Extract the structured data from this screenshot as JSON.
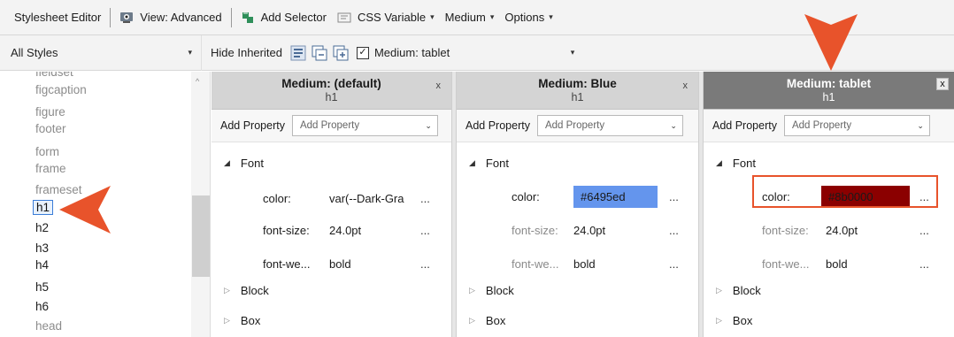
{
  "toolbar": {
    "title": "Stylesheet Editor",
    "view": "View: Advanced",
    "add_selector": "Add Selector",
    "css_variable": "CSS Variable",
    "medium": "Medium",
    "options": "Options"
  },
  "toolbar2": {
    "styles_filter": "All Styles",
    "hide_inherited": "Hide Inherited",
    "medium_check": "Medium: tablet"
  },
  "selector_list": {
    "items": [
      "fieldset",
      "figcaption",
      "figure",
      "footer",
      "form",
      "frame",
      "frameset",
      "h1",
      "h2",
      "h3",
      "h4",
      "h5",
      "h6",
      "head"
    ],
    "selected": "h1"
  },
  "columns": [
    {
      "title": "Medium: (default)",
      "selector": "h1",
      "close": "x",
      "add_property_label": "Add Property",
      "add_property_placeholder": "Add Property",
      "group_font": "Font",
      "props": [
        {
          "name": "color:",
          "value": "var(--Dark-Gra",
          "dots": "..."
        },
        {
          "name": "font-size:",
          "value": "24.0pt",
          "dots": "..."
        },
        {
          "name": "font-we...",
          "value": "bold",
          "dots": "..."
        }
      ],
      "group_block": "Block",
      "group_box": "Box"
    },
    {
      "title": "Medium: Blue",
      "selector": "h1",
      "close": "x",
      "add_property_label": "Add Property",
      "add_property_placeholder": "Add Property",
      "group_font": "Font",
      "props": [
        {
          "name": "color:",
          "value": "#6495ed",
          "dots": "..."
        },
        {
          "name": "font-size:",
          "value": "24.0pt",
          "dots": "..."
        },
        {
          "name": "font-we...",
          "value": "bold",
          "dots": "..."
        }
      ],
      "group_block": "Block",
      "group_box": "Box"
    },
    {
      "title": "Medium: tablet",
      "selector": "h1",
      "close": "x",
      "add_property_label": "Add Property",
      "add_property_placeholder": "Add Property",
      "group_font": "Font",
      "props": [
        {
          "name": "color:",
          "value": "#8b0000",
          "dots": "..."
        },
        {
          "name": "font-size:",
          "value": "24.0pt",
          "dots": "..."
        },
        {
          "name": "font-we...",
          "value": "bold",
          "dots": "..."
        }
      ],
      "group_block": "Block",
      "group_box": "Box"
    }
  ],
  "colors": {
    "blue_swatch": "#6495ed",
    "red_swatch": "#8b0000",
    "callout": "#e8532b",
    "active_header": "#7a7a7a"
  }
}
